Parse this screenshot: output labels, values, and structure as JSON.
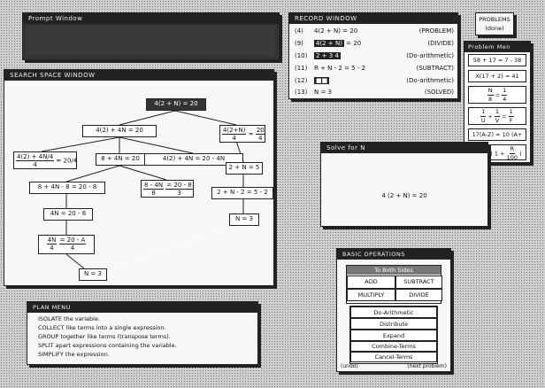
{
  "prompt_window": {
    "title": "Prompt Window"
  },
  "record_window": {
    "title": "RECORD WINDOW",
    "rows": [
      {
        "num": "(4)",
        "pre": "",
        "hl": "",
        "post": "4(2 + N) = 20",
        "label": "(PROBLEM)"
      },
      {
        "num": "(9)",
        "pre": "",
        "hl": "4(2 + N)",
        "post": "= 20",
        "label": "(DIVIDE)"
      },
      {
        "num": "(10)",
        "pre": "",
        "hl": "2 + 3 4",
        "post": "",
        "label": "(Do-arithmetic)"
      },
      {
        "num": "(11)",
        "pre": "",
        "hl": "",
        "post": "R + N - 2 = 5 - 2",
        "label": "(SUBTRACT)"
      },
      {
        "num": "(12)",
        "pre": "",
        "hl": "■■",
        "post": "",
        "label": "(Do-arithmetic)"
      },
      {
        "num": "(13)",
        "pre": "",
        "hl": "",
        "post": "N = 3",
        "label": "(SOLVED)"
      }
    ]
  },
  "problems_button": {
    "line1": "PROBLEMS",
    "line2": "(done)"
  },
  "problem_menu": {
    "title": "Problem Men",
    "items": [
      "58 + 17 = 7 - 38",
      "X(17 + 2) = 41",
      "N/8 = 1/4",
      "1/U + 1/V = 1/F",
      "17(A-Z) = 10 (A+",
      "A = P ( 1 + R/100 )"
    ]
  },
  "search_space": {
    "title": "SEARCH SPACE WINDOW",
    "nodes": {
      "root": "4(2 + N) = 20",
      "n1": "4(2) + 4N = 20",
      "n2": "4(2+N)/4 = 20/4",
      "n3a": "4(2) + 4N/4",
      "n3b": "= 20/4",
      "n4": "8 + 4N = 20",
      "n5": "4(2) + 4N = 20 - 4N",
      "n6": "2 + N = 5",
      "n7": "8 + 4N - 8 = 20 - 8",
      "n8a": "8 - 4N",
      "n8b": "8",
      "n8c": "= 20 - 8",
      "n8d": "3",
      "n9": "2 + N - 2 = 5 - 2",
      "n10": "4N = 20 - 8",
      "n11": "N = 3",
      "n12a": "4N",
      "n12b": "4",
      "n12c": "= 20 - A",
      "n12d": "4",
      "n13": "N = 3"
    }
  },
  "solve_window": {
    "title": "Solve for N",
    "equation": "4 (2 + N) = 20"
  },
  "basic_operations": {
    "title": "BASIC OPERATIONS",
    "to_both_sides": "To Both Sides",
    "add": "ADD",
    "subtract": "SUBTRACT",
    "multiply": "MULTIPLY",
    "divide": "DIVIDE",
    "ops": [
      "Do-Arithmetic",
      "Distribute",
      "Expand",
      "Combine-Terms",
      "Cancel-Terms"
    ],
    "undo": "(undo)",
    "next": "(next problem)"
  },
  "plan_menu": {
    "title": "PLAN MENU",
    "lines": [
      {
        "verb": "ISOLATE",
        "rest": " the variable."
      },
      {
        "verb": "COLLECT",
        "rest": " like terms into a single expression."
      },
      {
        "verb": "GROUP",
        "rest": " together like terms (transpose terms)."
      },
      {
        "verb": "SPLIT",
        "rest": " apart expressions containing the variable."
      },
      {
        "verb": "SIMPLIFY",
        "rest": " the expression."
      }
    ]
  }
}
